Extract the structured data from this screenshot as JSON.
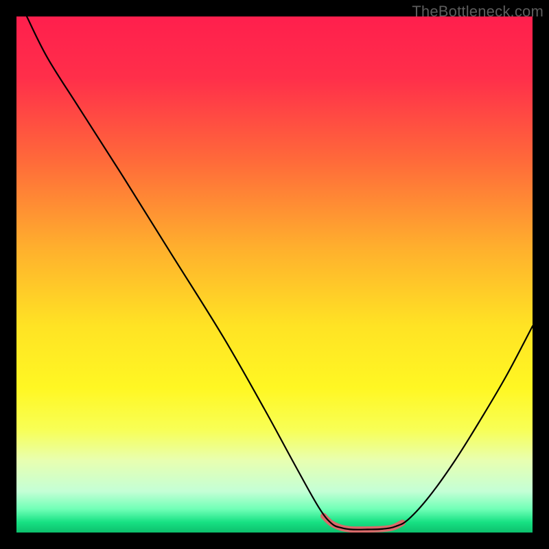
{
  "watermark": "TheBottleneck.com",
  "chart_data": {
    "type": "line",
    "title": "",
    "xlabel": "",
    "ylabel": "",
    "xlim": [
      0,
      100
    ],
    "ylim": [
      0,
      100
    ],
    "gradient_stops": [
      {
        "offset": 0.0,
        "color": "#ff1f4d"
      },
      {
        "offset": 0.12,
        "color": "#ff2f4a"
      },
      {
        "offset": 0.28,
        "color": "#ff6a3a"
      },
      {
        "offset": 0.45,
        "color": "#ffb02d"
      },
      {
        "offset": 0.6,
        "color": "#ffe324"
      },
      {
        "offset": 0.72,
        "color": "#fff723"
      },
      {
        "offset": 0.8,
        "color": "#f8ff55"
      },
      {
        "offset": 0.86,
        "color": "#e8ffb0"
      },
      {
        "offset": 0.92,
        "color": "#c4ffd6"
      },
      {
        "offset": 0.955,
        "color": "#6fffb6"
      },
      {
        "offset": 0.98,
        "color": "#17e183"
      },
      {
        "offset": 1.0,
        "color": "#0dbf6d"
      }
    ],
    "series": [
      {
        "name": "bottleneck-curve",
        "stroke": "#000000",
        "stroke_width": 2.2,
        "points": [
          {
            "x": 2.0,
            "y": 100.0
          },
          {
            "x": 6.0,
            "y": 92.0
          },
          {
            "x": 12.0,
            "y": 82.5
          },
          {
            "x": 20.0,
            "y": 70.0
          },
          {
            "x": 30.0,
            "y": 54.0
          },
          {
            "x": 40.0,
            "y": 38.0
          },
          {
            "x": 48.0,
            "y": 24.0
          },
          {
            "x": 54.0,
            "y": 13.0
          },
          {
            "x": 58.5,
            "y": 5.0
          },
          {
            "x": 61.0,
            "y": 1.8
          },
          {
            "x": 63.0,
            "y": 0.9
          },
          {
            "x": 65.0,
            "y": 0.6
          },
          {
            "x": 68.0,
            "y": 0.6
          },
          {
            "x": 71.0,
            "y": 0.7
          },
          {
            "x": 73.5,
            "y": 1.2
          },
          {
            "x": 76.0,
            "y": 2.6
          },
          {
            "x": 80.0,
            "y": 7.0
          },
          {
            "x": 85.0,
            "y": 14.0
          },
          {
            "x": 90.0,
            "y": 22.0
          },
          {
            "x": 95.0,
            "y": 30.5
          },
          {
            "x": 100.0,
            "y": 40.0
          }
        ]
      },
      {
        "name": "optimal-zone-highlight",
        "stroke": "#d86a6a",
        "stroke_width": 9,
        "linecap": "round",
        "points": [
          {
            "x": 59.5,
            "y": 3.2
          },
          {
            "x": 61.0,
            "y": 1.8
          },
          {
            "x": 63.0,
            "y": 0.9
          },
          {
            "x": 65.0,
            "y": 0.6
          },
          {
            "x": 68.0,
            "y": 0.6
          },
          {
            "x": 71.0,
            "y": 0.7
          },
          {
            "x": 73.0,
            "y": 1.0
          },
          {
            "x": 74.8,
            "y": 1.9
          }
        ]
      }
    ]
  }
}
